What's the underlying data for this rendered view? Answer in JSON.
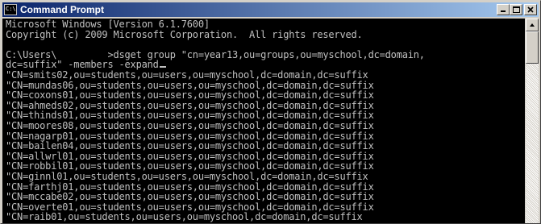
{
  "window": {
    "title": "Command Prompt",
    "icon": "console-icon",
    "buttons": [
      "minimize-icon",
      "maximize-icon",
      "close-icon"
    ]
  },
  "console": {
    "lines": [
      "Microsoft Windows [Version 6.1.7600]",
      "Copyright (c) 2009 Microsoft Corporation.  All rights reserved.",
      "",
      "C:\\Users\\         >dsget group \"cn=year13,ou=groups,ou=myschool,dc=domain,",
      "dc=suffix\" -members -expand",
      "\"CN=smits02,ou=students,ou=users,ou=myschool,dc=domain,dc=suffix",
      "\"CN=mundas06,ou=students,ou=users,ou=myschool,dc=domain,dc=suffix",
      "\"CN=coxons01,ou=students,ou=users,ou=myschool,dc=domain,dc=suffix",
      "\"CN=ahmeds02,ou=students,ou=users,ou=myschool,dc=domain,dc=suffix",
      "\"CN=thinds01,ou=students,ou=users,ou=myschool,dc=domain,dc=suffix",
      "\"CN=moores08,ou=students,ou=users,ou=myschool,dc=domain,dc=suffix",
      "\"CN=nagarp01,ou=students,ou=users,ou=myschool,dc=domain,dc=suffix",
      "\"CN=bailen04,ou=students,ou=users,ou=myschool,dc=domain,dc=suffix",
      "\"CN=allwrl01,ou=students,ou=users,ou=myschool,dc=domain,dc=suffix",
      "\"CN=robbil01,ou=students,ou=users,ou=myschool,dc=domain,dc=suffix",
      "\"CN=ginnl01,ou=students,ou=users,ou=myschool,dc=domain,dc=suffix",
      "\"CN=farthj01,ou=students,ou=users,ou=myschool,dc=domain,dc=suffix",
      "\"CN=mccabe02,ou=students,ou=users,ou=myschool,dc=domain,dc=suffix",
      "\"CN=overte01,ou=students,ou=users,ou=myschool,dc=domain,dc=suffix",
      "\"CN=raib01,ou=students,ou=users,ou=myschool,dc=domain,dc=suffix"
    ],
    "cursor_line": 4
  },
  "colors": {
    "console_bg": "#000000",
    "console_fg": "#c0c0c0",
    "titlebar_start": "#0a246a",
    "titlebar_end": "#a6caf0"
  }
}
